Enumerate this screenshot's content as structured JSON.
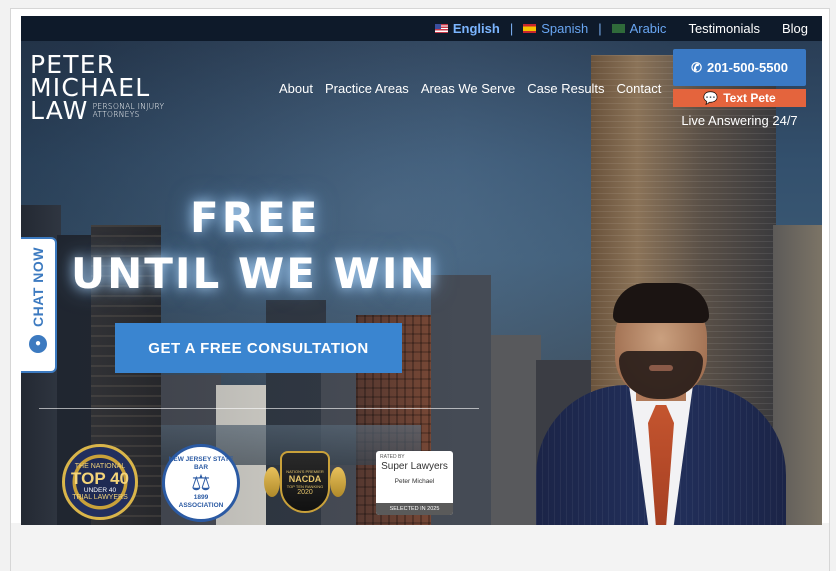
{
  "languages": [
    {
      "label": "English",
      "active": true
    },
    {
      "label": "Spanish",
      "active": false
    },
    {
      "label": "Arabic",
      "active": false
    }
  ],
  "language_separator": "|",
  "top_links": [
    "Testimonials",
    "Blog"
  ],
  "logo": {
    "line1": "PETER",
    "line2": "MICHAEL",
    "line3": "LAW",
    "sub1": "PERSONAL INJURY",
    "sub2": "ATTORNEYS"
  },
  "nav": [
    "About",
    "Practice Areas",
    "Areas We Serve",
    "Case Results",
    "Contact"
  ],
  "contact": {
    "phone": "201-500-5500",
    "text_label": "Text Pete",
    "live": "Live Answering 24/7"
  },
  "hero": {
    "line1": "FREE",
    "line2": "UNTIL WE WIN",
    "cta": "GET A FREE CONSULTATION"
  },
  "chat": {
    "label": "CHAT NOW"
  },
  "badges": {
    "top40": {
      "top": "THE NATIONAL",
      "big": "TOP 40",
      "sub": "UNDER 40",
      "bottom": "TRIAL LAWYERS"
    },
    "njsba": {
      "ring1": "NEW JERSEY STATE BAR",
      "ring2": "ASSOCIATION",
      "year": "1899"
    },
    "nacda": {
      "top": "NATION'S PREMIER",
      "name": "NACDA",
      "rank": "TOP TEN RANKING",
      "year": "2020"
    },
    "superlawyers": {
      "rated": "RATED BY",
      "name": "Super Lawyers",
      "person": "Peter Michael",
      "selected": "SELECTED IN 2025"
    }
  },
  "colors": {
    "topbar": "#0e1a2a",
    "link_blue": "#69a6f2",
    "phone_button": "#3a79c4",
    "text_button": "#e4643d",
    "cta_button": "#3a85d0"
  }
}
